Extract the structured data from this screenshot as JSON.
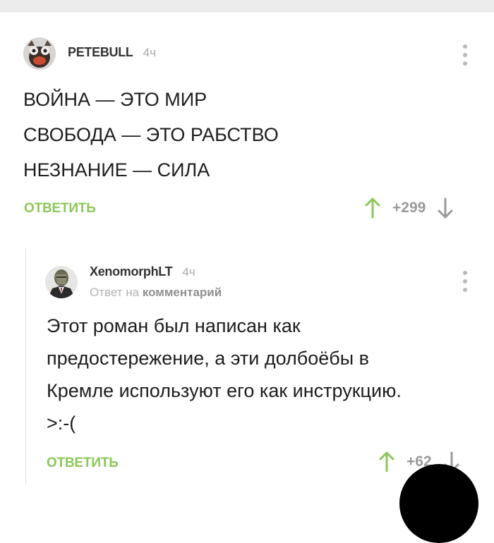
{
  "comment1": {
    "author": "PETEBULL",
    "time": "4ч",
    "lines": [
      "ВОЙНА — ЭТО МИР",
      "СВОБОДА — ЭТО РАБСТВО",
      "НЕЗНАНИЕ — СИЛА"
    ],
    "reply_label": "ОТВЕТИТЬ",
    "score": "+299"
  },
  "comment2": {
    "author": "XenomorphLT",
    "time": "4ч",
    "reply_to_prefix": "Ответ на",
    "reply_to_target": "комментарий",
    "lines": [
      "Этот роман был написан как",
      "предостережение, а эти долбоёбы в",
      "Кремле используют его как инструкцию.",
      ">:-("
    ],
    "reply_label": "ОТВЕТИТЬ",
    "score": "+62"
  },
  "colors": {
    "accent_green": "#8ac858",
    "muted_gray": "#a9a9a9"
  },
  "icons": {
    "upvote": "arrow-up-icon",
    "downvote": "arrow-down-icon",
    "menu": "more-vertical-icon"
  }
}
